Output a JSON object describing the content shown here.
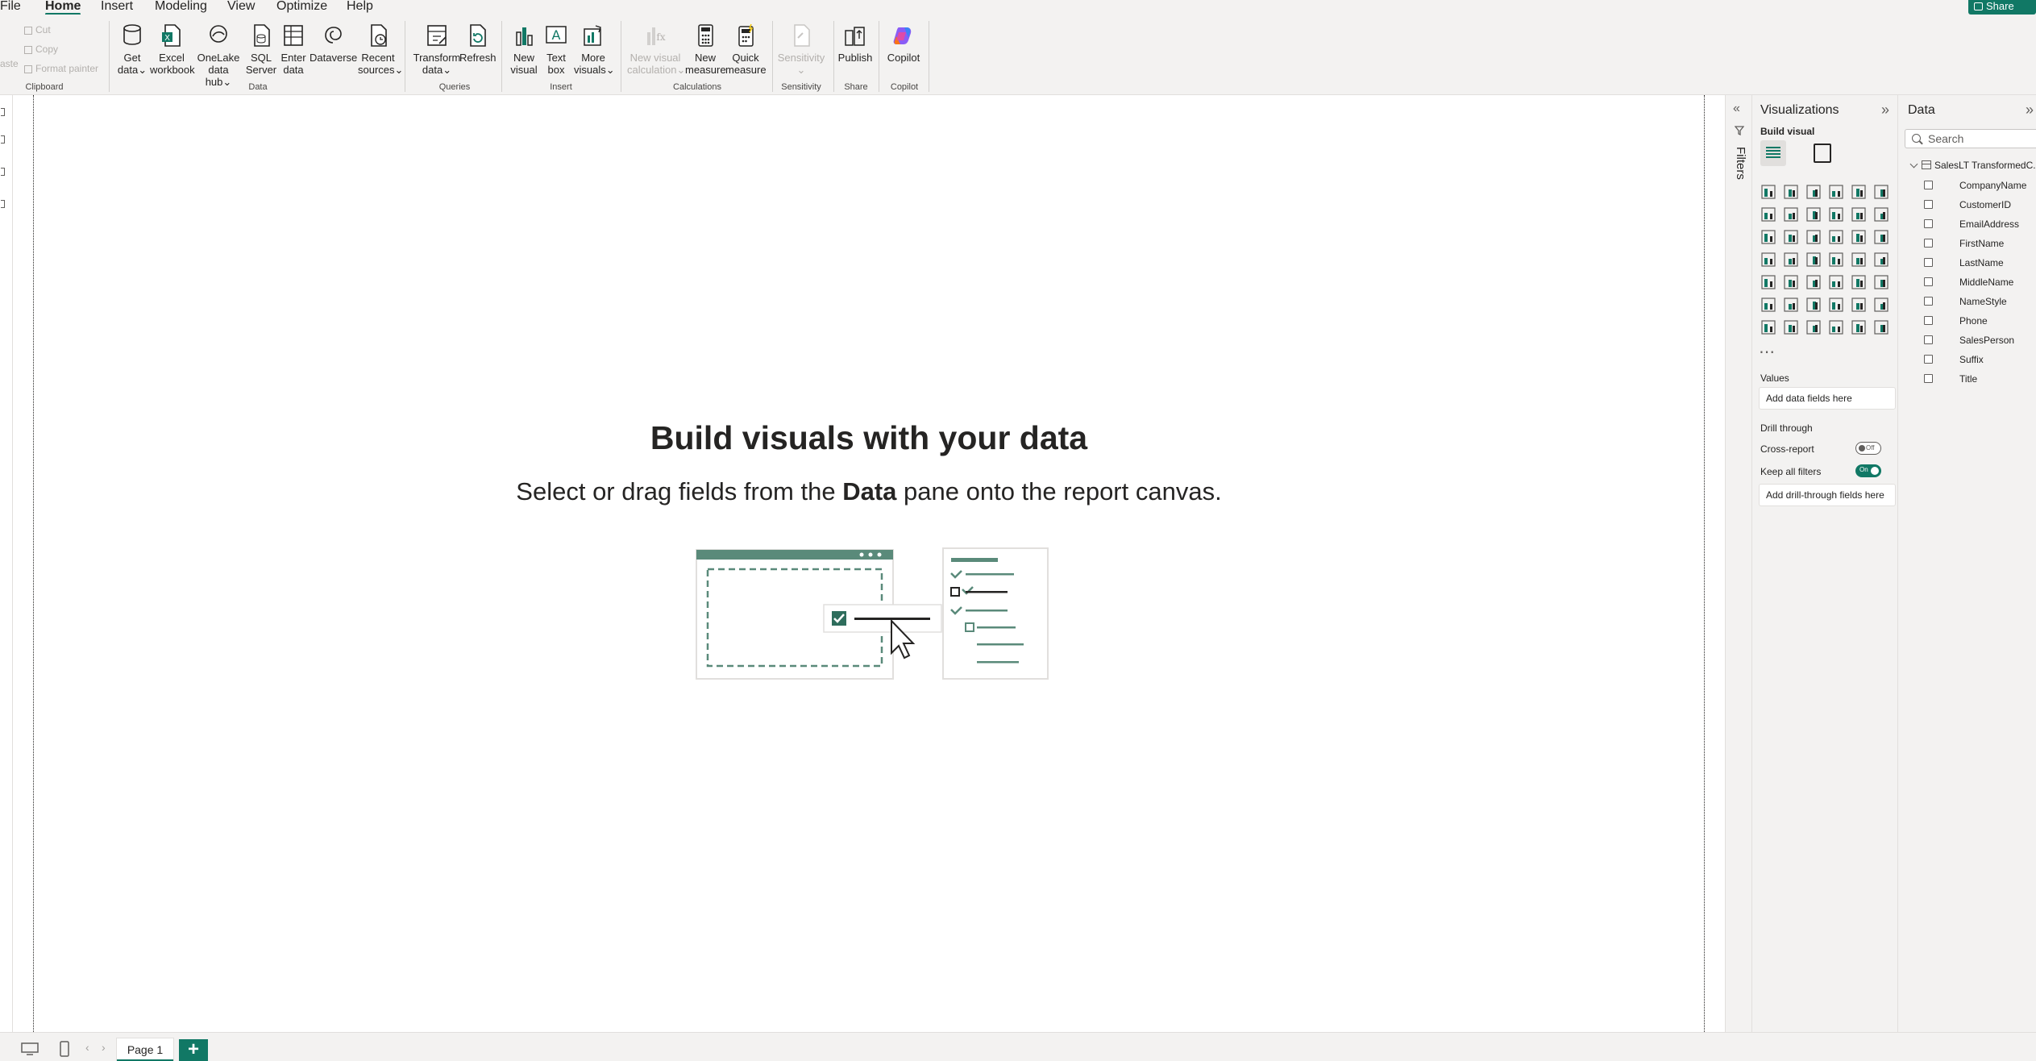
{
  "menu": {
    "items": [
      "File",
      "Home",
      "Insert",
      "Modeling",
      "View",
      "Optimize",
      "Help"
    ],
    "active": "Home",
    "share_label": "Share"
  },
  "ribbon": {
    "clipboard": {
      "paste_label": "aste",
      "cut_label": "Cut",
      "copy_label": "Copy",
      "format_painter_label": "Format painter",
      "group_label": "Clipboard"
    },
    "data": {
      "get_data": [
        "Get",
        "data"
      ],
      "excel": [
        "Excel",
        "workbook"
      ],
      "onelake": [
        "OneLake",
        "data hub"
      ],
      "sql": [
        "SQL",
        "Server"
      ],
      "enter": [
        "Enter",
        "data"
      ],
      "dataverse": [
        "Dataverse"
      ],
      "recent": [
        "Recent",
        "sources"
      ],
      "group_label": "Data"
    },
    "queries": {
      "transform": [
        "Transform",
        "data"
      ],
      "refresh": [
        "Refresh"
      ],
      "group_label": "Queries"
    },
    "insert": {
      "new_visual": [
        "New",
        "visual"
      ],
      "text_box": [
        "Text",
        "box"
      ],
      "more_visuals": [
        "More",
        "visuals"
      ],
      "group_label": "Insert"
    },
    "calculations": {
      "new_visual_calc": [
        "New visual",
        "calculation"
      ],
      "new_measure": [
        "New",
        "measure"
      ],
      "quick_measure": [
        "Quick",
        "measure"
      ],
      "group_label": "Calculations"
    },
    "sensitivity": {
      "label": [
        "Sensitivity"
      ],
      "group_label": "Sensitivity"
    },
    "share": {
      "publish": [
        "Publish"
      ],
      "group_label": "Share"
    },
    "copilot": {
      "label": [
        "Copilot"
      ],
      "group_label": "Copilot"
    }
  },
  "canvas": {
    "title": "Build visuals with your data",
    "subtitle_pre": "Select or drag fields from the ",
    "subtitle_bold": "Data",
    "subtitle_post": " pane onto the report canvas."
  },
  "pages": {
    "tabs": [
      "Page 1"
    ],
    "add_label": "+"
  },
  "filters": {
    "label": "Filters"
  },
  "visualizations": {
    "title": "Visualizations",
    "build_visual_label": "Build visual",
    "values_label": "Values",
    "values_placeholder": "Add data fields here",
    "drill_through_label": "Drill through",
    "cross_report_label": "Cross-report",
    "cross_report_state": "Off",
    "keep_filters_label": "Keep all filters",
    "keep_filters_state": "On",
    "drill_placeholder": "Add drill-through fields here"
  },
  "data_pane": {
    "title": "Data",
    "search_placeholder": "Search",
    "table_name": "SalesLT TransformedC...",
    "fields": [
      "CompanyName",
      "CustomerID",
      "EmailAddress",
      "FirstName",
      "LastName",
      "MiddleName",
      "NameStyle",
      "Phone",
      "SalesPerson",
      "Suffix",
      "Title"
    ]
  },
  "colors": {
    "accent": "#117865",
    "ribbon_bg": "#f3f2f1",
    "copilot": "#8a5cf6"
  }
}
